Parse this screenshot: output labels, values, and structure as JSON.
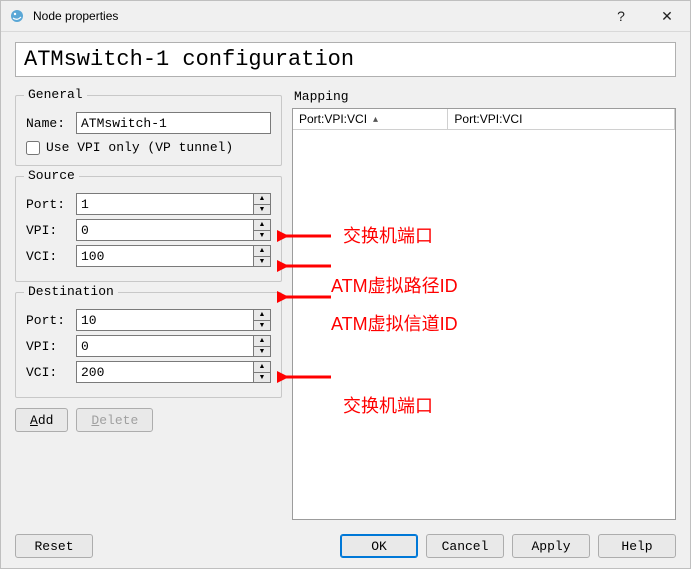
{
  "window": {
    "title": "Node properties",
    "help": "?",
    "close": "✕"
  },
  "header": "ATMswitch-1 configuration",
  "general": {
    "legend": "General",
    "name_label": "Name:",
    "name_value": "ATMswitch-1",
    "vpi_only_label": "Use VPI only (VP tunnel)",
    "vpi_only_checked": false
  },
  "source": {
    "legend": "Source",
    "port_label": "Port:",
    "port_value": "1",
    "vpi_label": "VPI:",
    "vpi_value": "0",
    "vci_label": "VCI:",
    "vci_value": "100"
  },
  "destination": {
    "legend": "Destination",
    "port_label": "Port:",
    "port_value": "10",
    "vpi_label": "VPI:",
    "vpi_value": "0",
    "vci_label": "VCI:",
    "vci_value": "200"
  },
  "mapping": {
    "legend": "Mapping",
    "col1": "Port:VPI:VCI",
    "col2": "Port:VPI:VCI"
  },
  "buttons": {
    "add_prefix": "A",
    "add_rest": "dd",
    "delete_prefix": "D",
    "delete_rest": "elete",
    "reset": "Reset",
    "ok": "OK",
    "cancel": "Cancel",
    "apply": "Apply",
    "help": "Help"
  },
  "annotations": {
    "a1": "交换机端口",
    "a2": "ATM虚拟路径ID",
    "a3": "ATM虚拟信道ID",
    "a4": "交换机端口"
  }
}
